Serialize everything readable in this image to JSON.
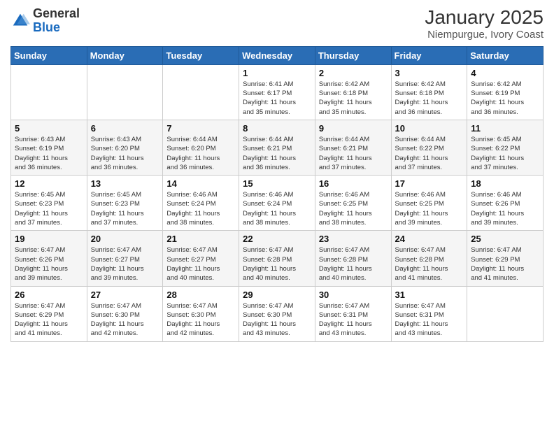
{
  "logo": {
    "general": "General",
    "blue": "Blue"
  },
  "header": {
    "title": "January 2025",
    "subtitle": "Niempurgue, Ivory Coast"
  },
  "weekdays": [
    "Sunday",
    "Monday",
    "Tuesday",
    "Wednesday",
    "Thursday",
    "Friday",
    "Saturday"
  ],
  "weeks": [
    [
      {
        "day": "",
        "info": ""
      },
      {
        "day": "",
        "info": ""
      },
      {
        "day": "",
        "info": ""
      },
      {
        "day": "1",
        "info": "Sunrise: 6:41 AM\nSunset: 6:17 PM\nDaylight: 11 hours\nand 35 minutes."
      },
      {
        "day": "2",
        "info": "Sunrise: 6:42 AM\nSunset: 6:18 PM\nDaylight: 11 hours\nand 35 minutes."
      },
      {
        "day": "3",
        "info": "Sunrise: 6:42 AM\nSunset: 6:18 PM\nDaylight: 11 hours\nand 36 minutes."
      },
      {
        "day": "4",
        "info": "Sunrise: 6:42 AM\nSunset: 6:19 PM\nDaylight: 11 hours\nand 36 minutes."
      }
    ],
    [
      {
        "day": "5",
        "info": "Sunrise: 6:43 AM\nSunset: 6:19 PM\nDaylight: 11 hours\nand 36 minutes."
      },
      {
        "day": "6",
        "info": "Sunrise: 6:43 AM\nSunset: 6:20 PM\nDaylight: 11 hours\nand 36 minutes."
      },
      {
        "day": "7",
        "info": "Sunrise: 6:44 AM\nSunset: 6:20 PM\nDaylight: 11 hours\nand 36 minutes."
      },
      {
        "day": "8",
        "info": "Sunrise: 6:44 AM\nSunset: 6:21 PM\nDaylight: 11 hours\nand 36 minutes."
      },
      {
        "day": "9",
        "info": "Sunrise: 6:44 AM\nSunset: 6:21 PM\nDaylight: 11 hours\nand 37 minutes."
      },
      {
        "day": "10",
        "info": "Sunrise: 6:44 AM\nSunset: 6:22 PM\nDaylight: 11 hours\nand 37 minutes."
      },
      {
        "day": "11",
        "info": "Sunrise: 6:45 AM\nSunset: 6:22 PM\nDaylight: 11 hours\nand 37 minutes."
      }
    ],
    [
      {
        "day": "12",
        "info": "Sunrise: 6:45 AM\nSunset: 6:23 PM\nDaylight: 11 hours\nand 37 minutes."
      },
      {
        "day": "13",
        "info": "Sunrise: 6:45 AM\nSunset: 6:23 PM\nDaylight: 11 hours\nand 37 minutes."
      },
      {
        "day": "14",
        "info": "Sunrise: 6:46 AM\nSunset: 6:24 PM\nDaylight: 11 hours\nand 38 minutes."
      },
      {
        "day": "15",
        "info": "Sunrise: 6:46 AM\nSunset: 6:24 PM\nDaylight: 11 hours\nand 38 minutes."
      },
      {
        "day": "16",
        "info": "Sunrise: 6:46 AM\nSunset: 6:25 PM\nDaylight: 11 hours\nand 38 minutes."
      },
      {
        "day": "17",
        "info": "Sunrise: 6:46 AM\nSunset: 6:25 PM\nDaylight: 11 hours\nand 39 minutes."
      },
      {
        "day": "18",
        "info": "Sunrise: 6:46 AM\nSunset: 6:26 PM\nDaylight: 11 hours\nand 39 minutes."
      }
    ],
    [
      {
        "day": "19",
        "info": "Sunrise: 6:47 AM\nSunset: 6:26 PM\nDaylight: 11 hours\nand 39 minutes."
      },
      {
        "day": "20",
        "info": "Sunrise: 6:47 AM\nSunset: 6:27 PM\nDaylight: 11 hours\nand 39 minutes."
      },
      {
        "day": "21",
        "info": "Sunrise: 6:47 AM\nSunset: 6:27 PM\nDaylight: 11 hours\nand 40 minutes."
      },
      {
        "day": "22",
        "info": "Sunrise: 6:47 AM\nSunset: 6:28 PM\nDaylight: 11 hours\nand 40 minutes."
      },
      {
        "day": "23",
        "info": "Sunrise: 6:47 AM\nSunset: 6:28 PM\nDaylight: 11 hours\nand 40 minutes."
      },
      {
        "day": "24",
        "info": "Sunrise: 6:47 AM\nSunset: 6:28 PM\nDaylight: 11 hours\nand 41 minutes."
      },
      {
        "day": "25",
        "info": "Sunrise: 6:47 AM\nSunset: 6:29 PM\nDaylight: 11 hours\nand 41 minutes."
      }
    ],
    [
      {
        "day": "26",
        "info": "Sunrise: 6:47 AM\nSunset: 6:29 PM\nDaylight: 11 hours\nand 41 minutes."
      },
      {
        "day": "27",
        "info": "Sunrise: 6:47 AM\nSunset: 6:30 PM\nDaylight: 11 hours\nand 42 minutes."
      },
      {
        "day": "28",
        "info": "Sunrise: 6:47 AM\nSunset: 6:30 PM\nDaylight: 11 hours\nand 42 minutes."
      },
      {
        "day": "29",
        "info": "Sunrise: 6:47 AM\nSunset: 6:30 PM\nDaylight: 11 hours\nand 43 minutes."
      },
      {
        "day": "30",
        "info": "Sunrise: 6:47 AM\nSunset: 6:31 PM\nDaylight: 11 hours\nand 43 minutes."
      },
      {
        "day": "31",
        "info": "Sunrise: 6:47 AM\nSunset: 6:31 PM\nDaylight: 11 hours\nand 43 minutes."
      },
      {
        "day": "",
        "info": ""
      }
    ]
  ]
}
